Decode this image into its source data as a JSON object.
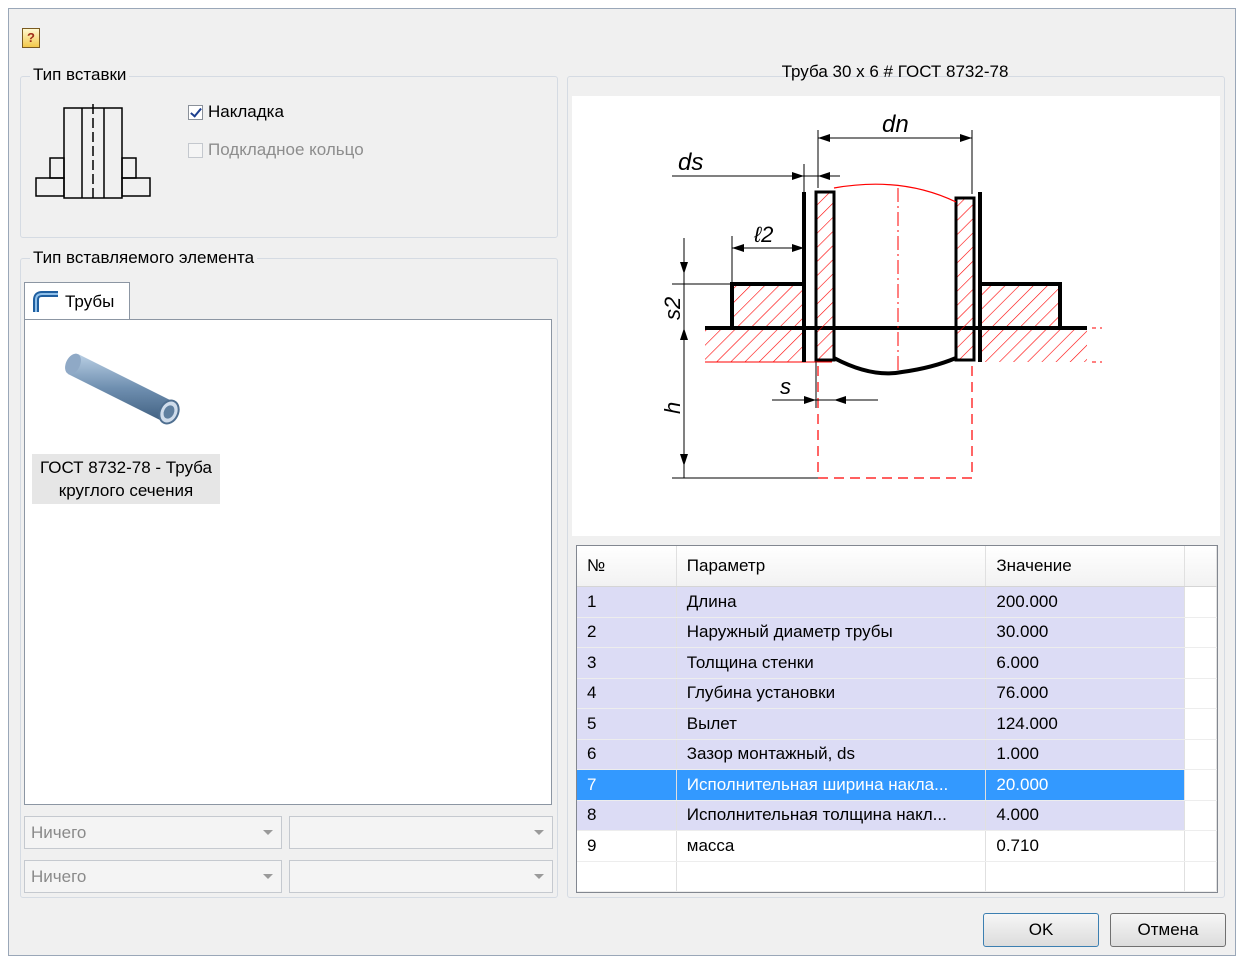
{
  "dialog": {
    "help_icon": "help-icon"
  },
  "insert_type": {
    "title": "Тип вставки",
    "overlay_label": "Накладка",
    "overlay_checked": true,
    "ring_label": "Подкладное кольцо",
    "ring_checked": false
  },
  "element_type": {
    "title": "Тип вставляемого элемента",
    "tab_label": "Трубы",
    "item_line1": "ГОСТ 8732-78 - Труба",
    "item_line2": "круглого сечения"
  },
  "combos": [
    {
      "value": "Ничего"
    },
    {
      "value": ""
    },
    {
      "value": "Ничего"
    },
    {
      "value": ""
    }
  ],
  "preview": {
    "title": "Труба 30 x 6 # ГОСТ 8732-78",
    "labels": {
      "dn": "dn",
      "ds": "ds",
      "l2": "ℓ2",
      "s2": "s2",
      "s": "s",
      "h": "h"
    }
  },
  "params_table": {
    "headers": [
      "№",
      "Параметр",
      "Значение"
    ],
    "rows": [
      {
        "n": "1",
        "param": "Длина",
        "value": "200.000"
      },
      {
        "n": "2",
        "param": "Наружный диаметр трубы",
        "value": "30.000"
      },
      {
        "n": "3",
        "param": "Толщина стенки",
        "value": "6.000"
      },
      {
        "n": "4",
        "param": "Глубина установки",
        "value": "76.000"
      },
      {
        "n": "5",
        "param": "Вылет",
        "value": "124.000"
      },
      {
        "n": "6",
        "param": "Зазор монтажный, ds",
        "value": "1.000"
      },
      {
        "n": "7",
        "param": "Исполнительная ширина накла...",
        "value": "20.000"
      },
      {
        "n": "8",
        "param": "Исполнительная толщина накл...",
        "value": "4.000"
      },
      {
        "n": "9",
        "param": "масса",
        "value": "0.710"
      }
    ],
    "selected_row": "7"
  },
  "buttons": {
    "ok": "OK",
    "cancel": "Отмена"
  },
  "colors": {
    "selection": "#3399ff",
    "row_highlight": "#dcdcf5",
    "drawing_red": "#ff0000"
  }
}
